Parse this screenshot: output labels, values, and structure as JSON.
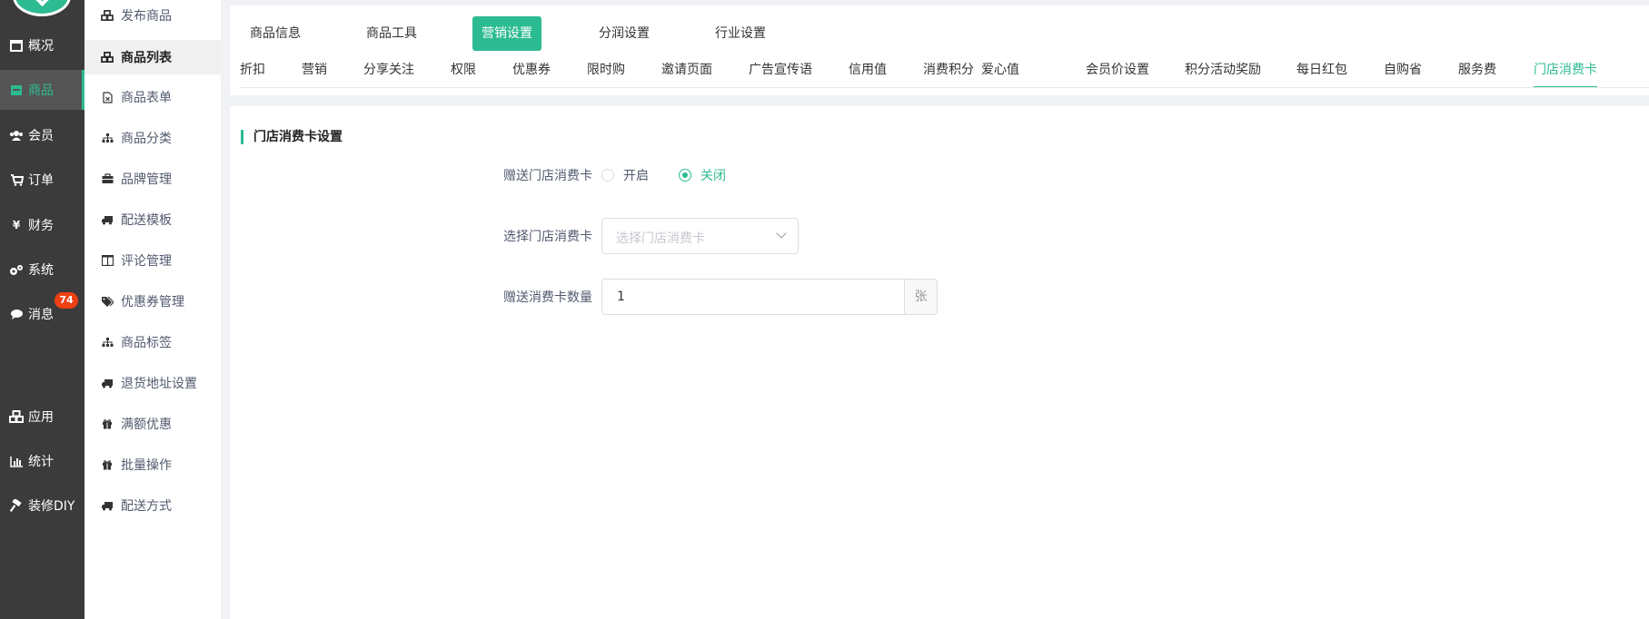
{
  "rail": {
    "items": [
      {
        "label": "概况",
        "icon": "dashboard-icon"
      },
      {
        "label": "商品",
        "icon": "goods-icon"
      },
      {
        "label": "会员",
        "icon": "users-icon"
      },
      {
        "label": "订单",
        "icon": "cart-icon"
      },
      {
        "label": "财务",
        "icon": "yen-icon"
      },
      {
        "label": "系统",
        "icon": "gears-icon"
      },
      {
        "label": "消息",
        "icon": "chat-icon"
      },
      {
        "label": "应用",
        "icon": "cubes-icon"
      },
      {
        "label": "统计",
        "icon": "bar-chart-icon"
      },
      {
        "label": "装修DIY",
        "icon": "hammer-icon"
      }
    ],
    "message_badge": "74"
  },
  "submenu": {
    "items": [
      {
        "label": "发布商品",
        "icon": "cubes-icon"
      },
      {
        "label": "商品列表",
        "icon": "cubes-icon"
      },
      {
        "label": "商品表单",
        "icon": "file-excel-icon"
      },
      {
        "label": "商品分类",
        "icon": "sitemap-icon"
      },
      {
        "label": "品牌管理",
        "icon": "briefcase-icon"
      },
      {
        "label": "配送模板",
        "icon": "truck-icon"
      },
      {
        "label": "评论管理",
        "icon": "columns-icon"
      },
      {
        "label": "优惠券管理",
        "icon": "tags-icon"
      },
      {
        "label": "商品标签",
        "icon": "sitemap-icon"
      },
      {
        "label": "退货地址设置",
        "icon": "truck-icon"
      },
      {
        "label": "满额优惠",
        "icon": "gift-icon"
      },
      {
        "label": "批量操作",
        "icon": "gift-icon"
      },
      {
        "label": "配送方式",
        "icon": "truck-icon"
      }
    ]
  },
  "top_tabs": [
    "商品信息",
    "商品工具",
    "营销设置",
    "分润设置",
    "行业设置"
  ],
  "sub_tabs": [
    "折扣",
    "营销",
    "分享关注",
    "权限",
    "优惠券",
    "限时购",
    "邀请页面",
    "广告宣传语",
    "信用值",
    "消费积分",
    "爱心值",
    "会员价设置",
    "积分活动奖励",
    "每日红包",
    "自购省",
    "服务费",
    "门店消费卡"
  ],
  "form": {
    "section_title": "门店消费卡设置",
    "gift_label": "赠送门店消费卡",
    "radio_on": "开启",
    "radio_off": "关闭",
    "select_label": "选择门店消费卡",
    "select_placeholder": "选择门店消费卡",
    "qty_label": "赠送消费卡数量",
    "qty_value": "1",
    "qty_unit": "张"
  },
  "colors": {
    "accent": "#2dbb92",
    "rail_bg": "#3b3b3b",
    "badge": "#ed4014"
  }
}
